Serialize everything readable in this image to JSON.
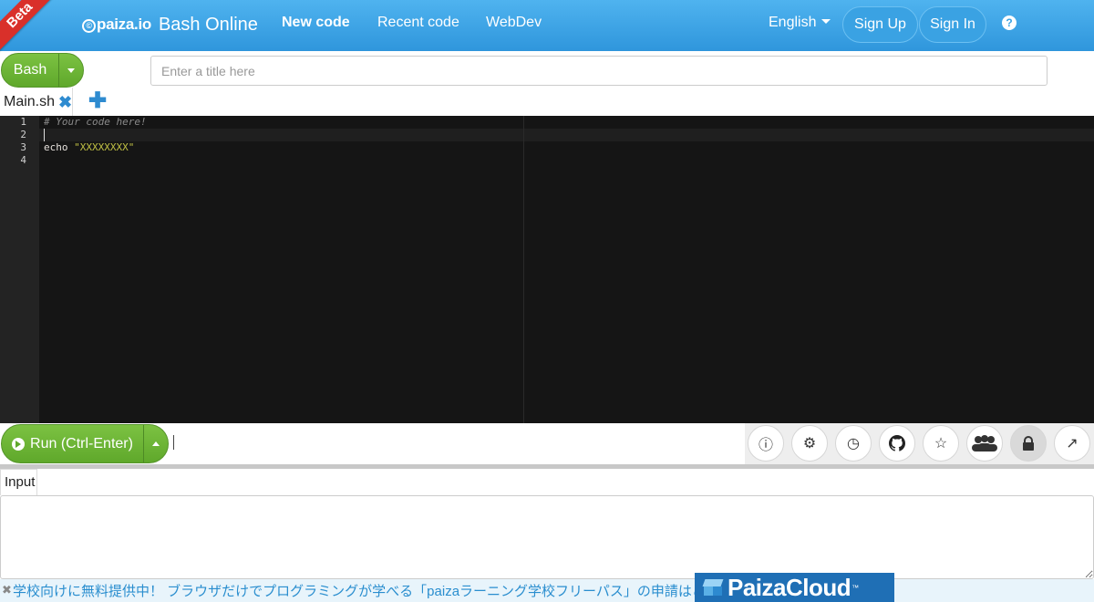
{
  "nav": {
    "beta": "Beta",
    "logo": "paiza.io",
    "logo_mark": "©",
    "title": "Bash Online",
    "links": [
      "New code",
      "Recent code",
      "WebDev"
    ],
    "language": "English",
    "sign_up": "Sign Up",
    "sign_in": "Sign In",
    "help": "?"
  },
  "toolbar": {
    "language_button": "Bash",
    "title_placeholder": "Enter a title here"
  },
  "tabs": {
    "file_name": "Main.sh",
    "close_glyph": "✖",
    "add_glyph": "✚"
  },
  "editor": {
    "line_numbers": [
      "1",
      "2",
      "3",
      "4"
    ],
    "lines": {
      "l1": "# Your code here!",
      "l3_kw": "echo ",
      "l3_str": "\"XXXXXXXX\""
    }
  },
  "run": {
    "label": "Run (Ctrl-Enter)",
    "cursor_text": "|"
  },
  "tools": {
    "info": "ⓘ",
    "settings": "⚙",
    "history": "◷",
    "github": "●",
    "star": "☆",
    "people": "👥",
    "lock": "🔒",
    "share": "↗"
  },
  "input": {
    "tab_label": "Input"
  },
  "footer": {
    "close": "✖",
    "text": "学校向けに無料提供中！ ブラウザだけでプログラミングが学べる「paizaラーニング学校フリーパス」の申請はこちら",
    "cloud_brand": "PaizaCloud",
    "cloud_tm": "™"
  },
  "colors": {
    "nav_blue": "#2f96dc",
    "run_green": "#6ab234",
    "editor_bg": "#151515",
    "beta_red": "#d9302a"
  }
}
